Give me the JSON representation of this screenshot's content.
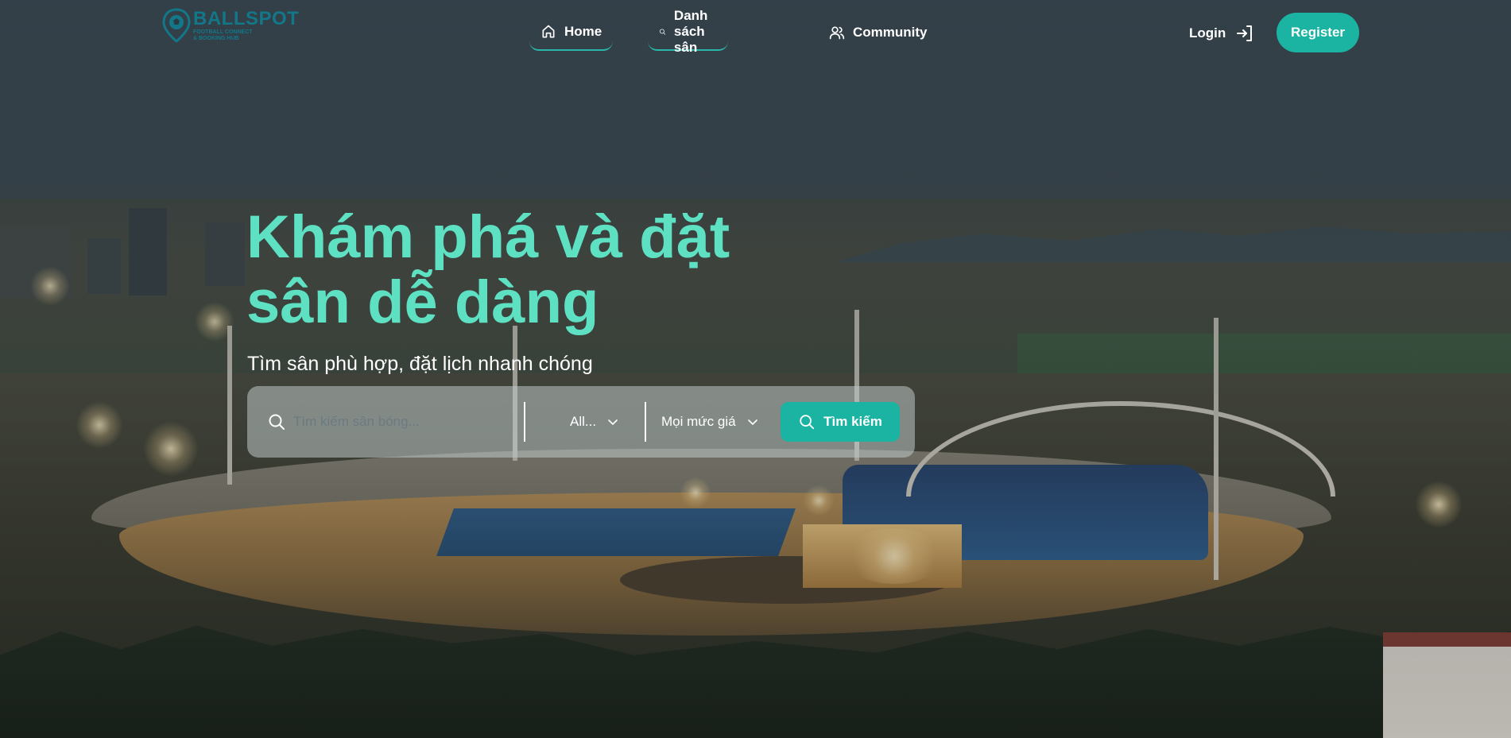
{
  "brand": {
    "name": "BALLSPOT",
    "tagline_line1": "FOOTBALL CONNECT",
    "tagline_line2": "& BOOKING HUB",
    "color": "#13778a"
  },
  "nav": {
    "items": [
      {
        "label": "Home",
        "icon": "home-icon",
        "active": true
      },
      {
        "label": "Danh sách sân",
        "icon": "search-icon",
        "active": true
      },
      {
        "label": "Community",
        "icon": "users-icon",
        "active": false
      }
    ],
    "login_label": "Login",
    "register_label": "Register"
  },
  "hero": {
    "title_line1": "Khám phá và đặt",
    "title_line2": "sân dễ dàng",
    "subtitle": "Tìm sân phù hợp, đặt lịch nhanh chóng"
  },
  "search": {
    "placeholder": "Tìm kiếm sân bóng...",
    "category_value": "All...",
    "price_value": "Mọi mức giá",
    "button_label": "Tìm kiếm"
  },
  "colors": {
    "accent": "#1bb3a2",
    "title": "#5ee0c3"
  }
}
